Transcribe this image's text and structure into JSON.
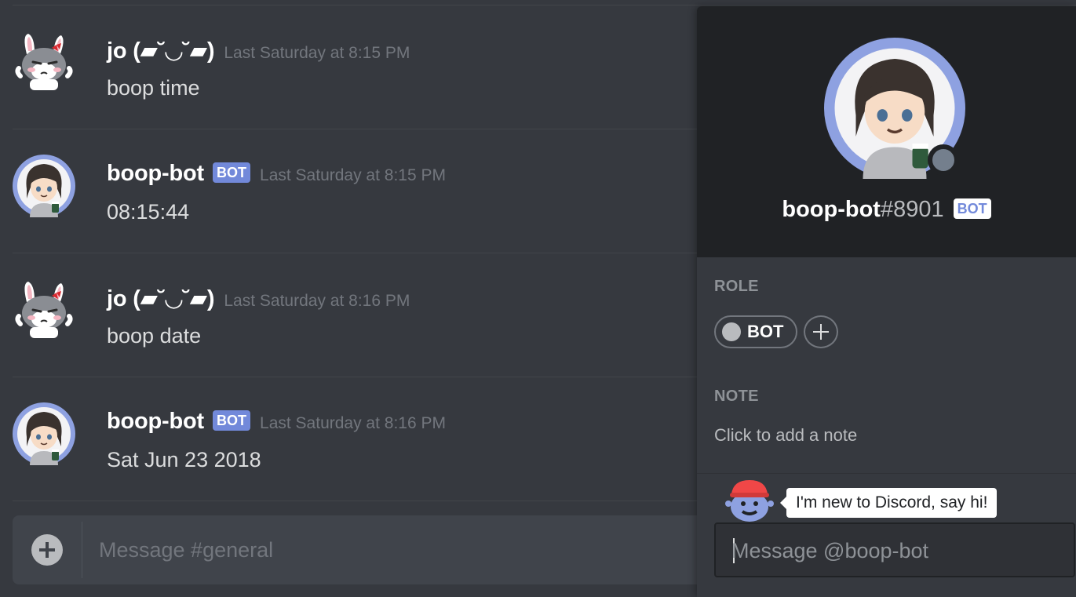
{
  "channel": {
    "messages": [
      {
        "author": "jo (▰˘◡˘▰)",
        "bot_badge": "",
        "timestamp": "Last Saturday at 8:15 PM",
        "content": "boop time",
        "avatar_icon": "bunny-avatar-icon"
      },
      {
        "author": "boop-bot",
        "bot_badge": "BOT",
        "timestamp": "Last Saturday at 8:15 PM",
        "content": "08:15:44",
        "avatar_icon": "girl-avatar-icon"
      },
      {
        "author": "jo (▰˘◡˘▰)",
        "bot_badge": "",
        "timestamp": "Last Saturday at 8:16 PM",
        "content": "boop date",
        "avatar_icon": "bunny-avatar-icon"
      },
      {
        "author": "boop-bot",
        "bot_badge": "BOT",
        "timestamp": "Last Saturday at 8:16 PM",
        "content": "Sat Jun 23 2018",
        "avatar_icon": "girl-avatar-icon"
      }
    ],
    "composer": {
      "placeholder": "Message #general",
      "add_icon": "plus-circle-icon"
    }
  },
  "profile": {
    "username": "boop-bot",
    "discriminator": "#8901",
    "bot_badge": "BOT",
    "status_color": "#747f8d",
    "roles_title": "ROLE",
    "roles": [
      {
        "name": "BOT",
        "color": "#b9bbbe"
      }
    ],
    "note_title": "NOTE",
    "note_placeholder": "Click to add a note",
    "new_user_tip": "I'm new to Discord, say hi!",
    "dm_placeholder": "Message @boop-bot"
  },
  "colors": {
    "background": "#36393f",
    "header": "#202225",
    "blurple": "#7289da",
    "text": "#dcddde",
    "muted": "#72767d"
  }
}
